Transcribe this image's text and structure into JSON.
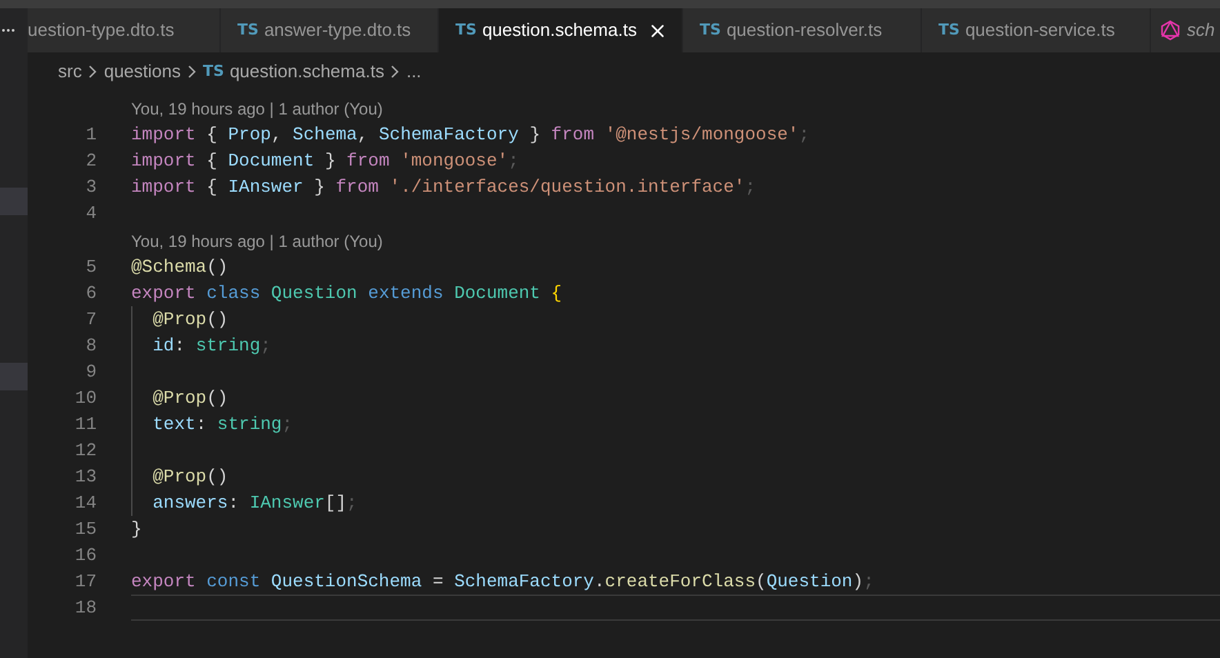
{
  "tabs": [
    {
      "label": "uestion-type.dto.ts",
      "selected": false
    },
    {
      "badge": "TS",
      "label": "answer-type.dto.ts",
      "selected": false
    },
    {
      "badge": "TS",
      "label": "question.schema.ts",
      "selected": true
    },
    {
      "badge": "TS",
      "label": "question-resolver.ts",
      "selected": false
    },
    {
      "badge": "TS",
      "label": "question-service.ts",
      "selected": false
    },
    {
      "label": "sch",
      "selected": false
    }
  ],
  "breadcrumb": [
    {
      "label": "src"
    },
    {
      "label": "questions"
    },
    {
      "badge": "TS",
      "label": "question.schema.ts"
    },
    {
      "label": "..."
    }
  ],
  "editor": {
    "lines": [
      {
        "kind": "lens",
        "text": "You, 19 hours ago | 1 author (You)"
      },
      {
        "kind": "code",
        "number": "1",
        "guide": false,
        "current": false,
        "tokens": [
          {
            "t": "import ",
            "kind": "keyword"
          },
          {
            "t": "{ ",
            "kind": "punct"
          },
          {
            "t": "Prop",
            "kind": "variable"
          },
          {
            "t": ", ",
            "kind": "punct"
          },
          {
            "t": "Schema",
            "kind": "variable"
          },
          {
            "t": ", ",
            "kind": "punct"
          },
          {
            "t": "SchemaFactory ",
            "kind": "variable"
          },
          {
            "t": "} ",
            "kind": "punct"
          },
          {
            "t": "from ",
            "kind": "keyword"
          },
          {
            "t": "'@nestjs/mongoose'",
            "kind": "string"
          },
          {
            "t": ";",
            "kind": "dim"
          }
        ]
      },
      {
        "kind": "code",
        "number": "2",
        "guide": false,
        "current": false,
        "tokens": [
          {
            "t": "import ",
            "kind": "keyword"
          },
          {
            "t": "{ ",
            "kind": "punct"
          },
          {
            "t": "Document ",
            "kind": "variable"
          },
          {
            "t": "} ",
            "kind": "punct"
          },
          {
            "t": "from ",
            "kind": "keyword"
          },
          {
            "t": "'mongoose'",
            "kind": "string"
          },
          {
            "t": ";",
            "kind": "dim"
          }
        ]
      },
      {
        "kind": "code",
        "number": "3",
        "guide": false,
        "current": false,
        "tokens": [
          {
            "t": "import ",
            "kind": "keyword"
          },
          {
            "t": "{ ",
            "kind": "punct"
          },
          {
            "t": "IAnswer ",
            "kind": "variable"
          },
          {
            "t": "} ",
            "kind": "punct"
          },
          {
            "t": "from ",
            "kind": "keyword"
          },
          {
            "t": "'./interfaces/question.interface'",
            "kind": "string"
          },
          {
            "t": ";",
            "kind": "dim"
          }
        ]
      },
      {
        "kind": "code",
        "number": "4",
        "guide": false,
        "current": false
      },
      {
        "kind": "lens",
        "text": "You, 19 hours ago | 1 author (You)"
      },
      {
        "kind": "code",
        "number": "5",
        "guide": false,
        "current": false,
        "tokens": [
          {
            "t": "@Schema",
            "kind": "function"
          },
          {
            "t": "()",
            "kind": "punct"
          }
        ]
      },
      {
        "kind": "code",
        "number": "6",
        "guide": false,
        "current": false,
        "tokens": [
          {
            "t": "export ",
            "kind": "keyword"
          },
          {
            "t": "class ",
            "kind": "storage"
          },
          {
            "t": "Question ",
            "kind": "type"
          },
          {
            "t": "extends ",
            "kind": "storage"
          },
          {
            "t": "Document ",
            "kind": "type"
          },
          {
            "t": "{",
            "kind": "bracket"
          }
        ]
      },
      {
        "kind": "code",
        "number": "7",
        "guide": true,
        "current": false,
        "tokens": [
          {
            "t": "@Prop",
            "kind": "function"
          },
          {
            "t": "()",
            "kind": "punct"
          }
        ]
      },
      {
        "kind": "code",
        "number": "8",
        "guide": true,
        "current": false,
        "tokens": [
          {
            "t": "id",
            "kind": "variable"
          },
          {
            "t": ": ",
            "kind": "punct"
          },
          {
            "t": "string",
            "kind": "type"
          },
          {
            "t": ";",
            "kind": "dim"
          }
        ]
      },
      {
        "kind": "code",
        "number": "9",
        "guide": true,
        "current": false
      },
      {
        "kind": "code",
        "number": "10",
        "guide": true,
        "current": false,
        "tokens": [
          {
            "t": "@Prop",
            "kind": "function"
          },
          {
            "t": "()",
            "kind": "punct"
          }
        ]
      },
      {
        "kind": "code",
        "number": "11",
        "guide": true,
        "current": false,
        "tokens": [
          {
            "t": "text",
            "kind": "variable"
          },
          {
            "t": ": ",
            "kind": "punct"
          },
          {
            "t": "string",
            "kind": "type"
          },
          {
            "t": ";",
            "kind": "dim"
          }
        ]
      },
      {
        "kind": "code",
        "number": "12",
        "guide": true,
        "current": false
      },
      {
        "kind": "code",
        "number": "13",
        "guide": true,
        "current": false,
        "tokens": [
          {
            "t": "@Prop",
            "kind": "function"
          },
          {
            "t": "()",
            "kind": "punct"
          }
        ]
      },
      {
        "kind": "code",
        "number": "14",
        "guide": true,
        "current": false,
        "tokens": [
          {
            "t": "answers",
            "kind": "variable"
          },
          {
            "t": ": ",
            "kind": "punct"
          },
          {
            "t": "IAnswer",
            "kind": "type"
          },
          {
            "t": "[]",
            "kind": "punct"
          },
          {
            "t": ";",
            "kind": "dim"
          }
        ]
      },
      {
        "kind": "code",
        "number": "15",
        "guide": false,
        "current": false,
        "tokens": [
          {
            "t": "}",
            "kind": "punct"
          }
        ]
      },
      {
        "kind": "code",
        "number": "16",
        "guide": false,
        "current": false
      },
      {
        "kind": "code",
        "number": "17",
        "guide": false,
        "current": false,
        "tokens": [
          {
            "t": "export ",
            "kind": "keyword"
          },
          {
            "t": "const ",
            "kind": "storage"
          },
          {
            "t": "QuestionSchema ",
            "kind": "variable"
          },
          {
            "t": "= ",
            "kind": "punct"
          },
          {
            "t": "SchemaFactory",
            "kind": "variable"
          },
          {
            "t": ".",
            "kind": "punct"
          },
          {
            "t": "createForClass",
            "kind": "function"
          },
          {
            "t": "(",
            "kind": "punct"
          },
          {
            "t": "Question",
            "kind": "variable"
          },
          {
            "t": ")",
            "kind": "punct"
          },
          {
            "t": ";",
            "kind": "dim"
          }
        ]
      },
      {
        "kind": "code",
        "number": "18",
        "guide": false,
        "current": true
      }
    ]
  }
}
